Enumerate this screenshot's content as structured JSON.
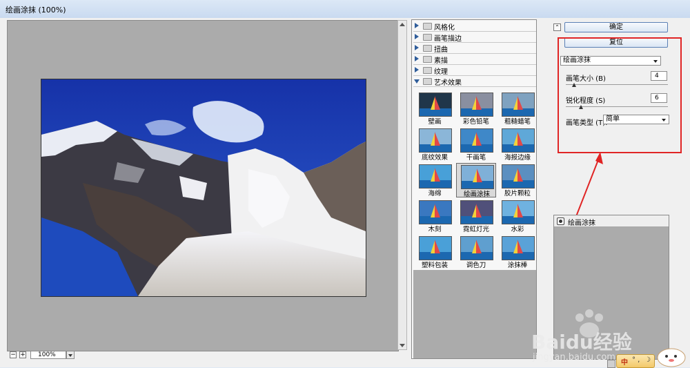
{
  "window": {
    "title": "绘画涂抹 (100%)"
  },
  "zoom": {
    "value": "100%",
    "minus": "−",
    "plus": "+"
  },
  "categories": [
    {
      "label": "风格化",
      "open": false
    },
    {
      "label": "画笔描边",
      "open": false
    },
    {
      "label": "扭曲",
      "open": false
    },
    {
      "label": "素描",
      "open": false
    },
    {
      "label": "纹理",
      "open": false
    },
    {
      "label": "艺术效果",
      "open": true
    }
  ],
  "filters": [
    {
      "label": "壁画"
    },
    {
      "label": "彩色铅笔"
    },
    {
      "label": "粗糙蜡笔"
    },
    {
      "label": "底纹效果"
    },
    {
      "label": "干画笔"
    },
    {
      "label": "海报边缘"
    },
    {
      "label": "海绵"
    },
    {
      "label": "绘画涂抹",
      "selected": true
    },
    {
      "label": "胶片颗粒"
    },
    {
      "label": "木刻"
    },
    {
      "label": "霓虹灯光"
    },
    {
      "label": "水彩"
    },
    {
      "label": "塑料包装"
    },
    {
      "label": "调色刀"
    },
    {
      "label": "涂抹棒"
    }
  ],
  "buttons": {
    "ok": "确定",
    "reset": "复位"
  },
  "settings": {
    "filter_select": "绘画涂抹",
    "brush_size": {
      "label": "画笔大小 (B)",
      "value": "4",
      "fraction": 0.08
    },
    "sharpness": {
      "label": "锐化程度 (S)",
      "value": "6",
      "fraction": 0.15
    },
    "brush_type": {
      "label": "画笔类型 (T):",
      "value": "简单"
    }
  },
  "layers": {
    "item": "绘画涂抹"
  },
  "ime": {
    "char": "中",
    "symbols": "° ,",
    "moon": "☽"
  },
  "watermark": {
    "brand": "Baidu经验",
    "url": "jingyan.baidu.com"
  },
  "colors": {
    "highlight_box": "#e02424",
    "arrow": "#e02424"
  }
}
